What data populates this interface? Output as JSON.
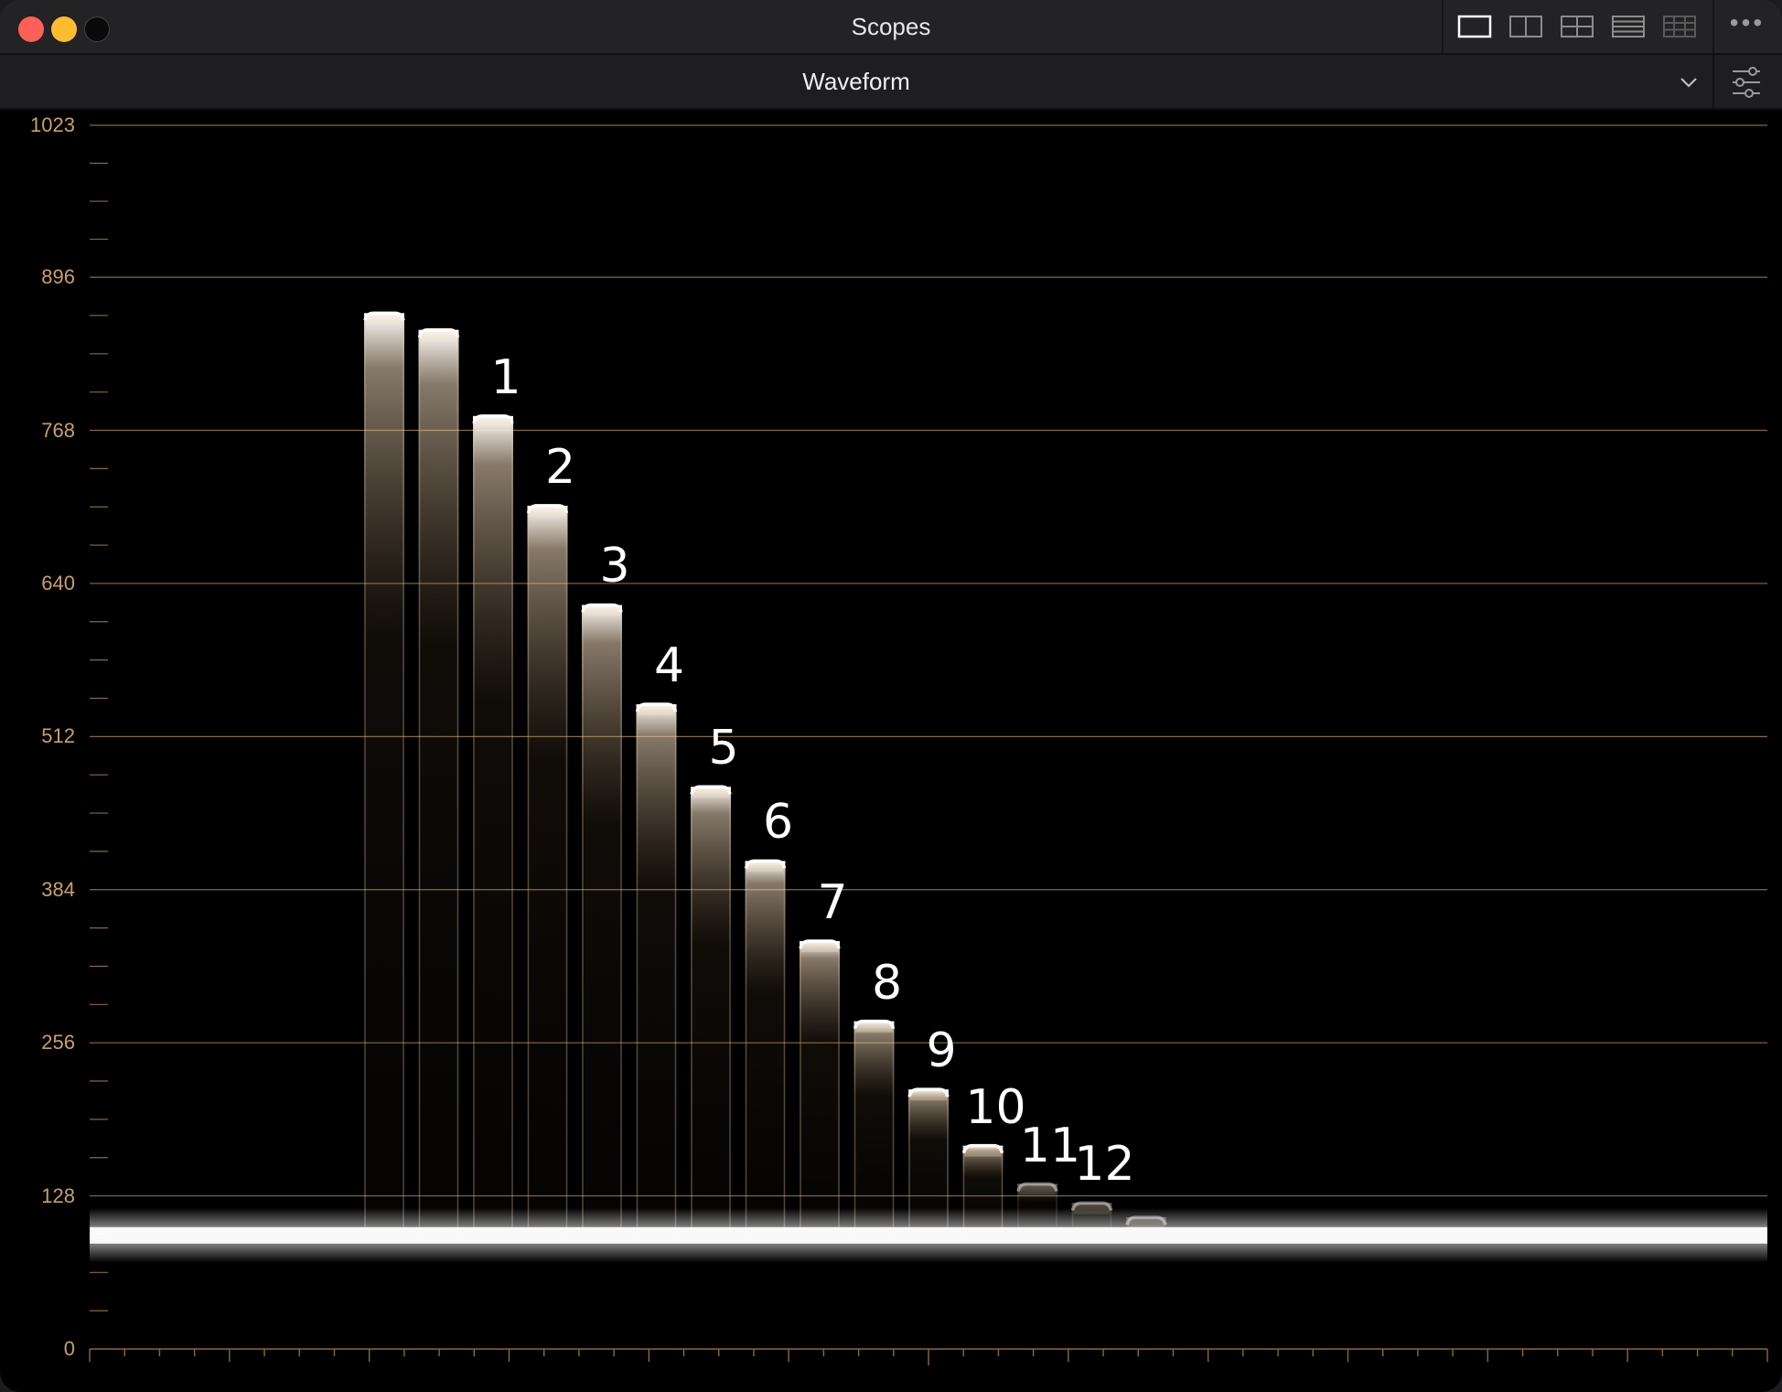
{
  "window": {
    "title": "Scopes"
  },
  "toolbar": {
    "layout_buttons": [
      {
        "name": "single-view-icon",
        "active": true
      },
      {
        "name": "dual-view-icon",
        "active": false
      },
      {
        "name": "quad-view-icon",
        "active": false
      },
      {
        "name": "stacked-view-icon",
        "active": false
      },
      {
        "name": "grid-view-icon",
        "active": false
      }
    ],
    "more_label": "•••"
  },
  "scope_selector": {
    "selected": "Waveform"
  },
  "colors": {
    "graticule": "#8a6a33",
    "axis_text": "#c9a063",
    "trace": "#ffffff"
  },
  "chart_data": {
    "type": "waveform",
    "y_ticks": [
      "1023",
      "896",
      "768",
      "640",
      "512",
      "384",
      "256",
      "128",
      "0"
    ],
    "ylim": [
      0,
      1023
    ],
    "baseline_level": 95,
    "steps": [
      {
        "label": "",
        "level": 866
      },
      {
        "label": "",
        "level": 852
      },
      {
        "label": "1",
        "level": 780
      },
      {
        "label": "2",
        "level": 705
      },
      {
        "label": "3",
        "level": 622
      },
      {
        "label": "4",
        "level": 539
      },
      {
        "label": "5",
        "level": 470
      },
      {
        "label": "6",
        "level": 408
      },
      {
        "label": "7",
        "level": 341
      },
      {
        "label": "8",
        "level": 274
      },
      {
        "label": "9",
        "level": 217
      },
      {
        "label": "10",
        "level": 170
      },
      {
        "label": "11",
        "level": 138
      },
      {
        "label": "12",
        "level": 122
      },
      {
        "label": "",
        "level": 110
      }
    ]
  }
}
